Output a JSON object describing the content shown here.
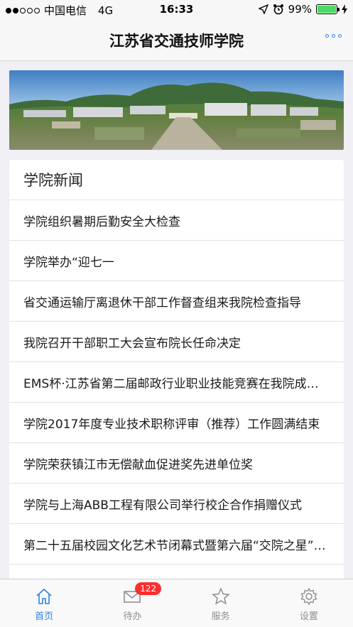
{
  "status_bar": {
    "carrier": "中国电信",
    "network": "4G",
    "time": "16:33",
    "battery": "99%",
    "battery_level": 0.99
  },
  "nav": {
    "title": "江苏省交通技师学院",
    "more_icon": "more-dots-icon",
    "accent": "#2b82e8"
  },
  "news": {
    "section_title": "学院新闻",
    "items": [
      "学院组织暑期后勤安全大检查",
      "学院举办“迎七一",
      "省交通运输厅离退休干部工作督查组来我院检查指导",
      "我院召开干部职工大会宣布院长任命决定",
      "EMS杯·江苏省第二届邮政行业职业技能竞赛在我院成功举办",
      "学院2017年度专业技术职称评审（推荐）工作圆满结束",
      "学院荣获镇江市无偿献血促进奖先进单位奖",
      "学院与上海ABB工程有限公司举行校企合作捐赠仪式",
      "第二十五届校园文化艺术节闭幕式暨第六届“交院之星”颁奖典礼"
    ]
  },
  "tabs": [
    {
      "label": "首页",
      "icon": "home-icon"
    },
    {
      "label": "待办",
      "icon": "mail-icon",
      "badge": "122"
    },
    {
      "label": "服务",
      "icon": "star-icon"
    },
    {
      "label": "设置",
      "icon": "gear-icon"
    }
  ]
}
